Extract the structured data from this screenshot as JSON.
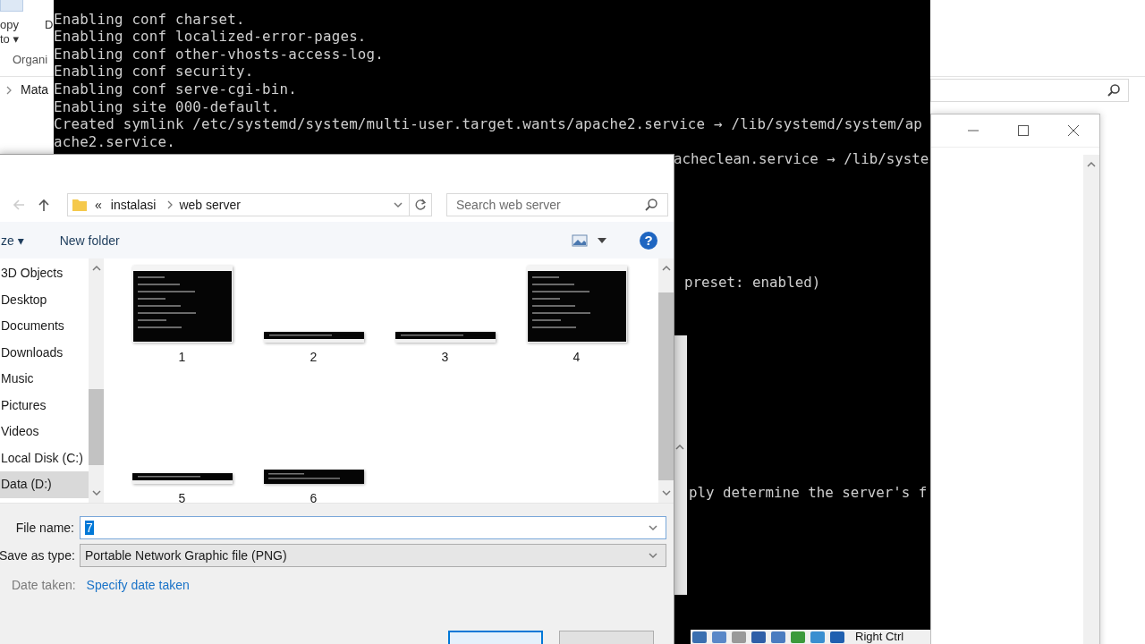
{
  "background_window": {
    "ribbon_labels": [
      "opy",
      "to ▾",
      "D"
    ],
    "group_label": "Organi",
    "nav_item": "Mata"
  },
  "terminal": {
    "lines": [
      "Enabling conf charset.",
      "Enabling conf localized-error-pages.",
      "Enabling conf other-vhosts-access-log.",
      "Enabling conf security.",
      "Enabling conf serve-cgi-bin.",
      "Enabling site 000-default.",
      "Created symlink /etc/systemd/system/multi-user.target.wants/apache2.service → /lib/systemd/system/ap",
      "ache2.service."
    ],
    "peek_lines": [
      "acheclean.service → /lib/syste",
      "preset: enabled)",
      "ply determine the server's f"
    ],
    "host_key": "Right Ctrl"
  },
  "save_dialog": {
    "address": {
      "overflow": "«",
      "crumbs": [
        "instalasi",
        "web server"
      ]
    },
    "search": {
      "placeholder": "Search web server"
    },
    "toolbar": {
      "organize": "ze ▾",
      "new_folder": "New folder",
      "help": "?"
    },
    "nav_items": [
      {
        "label": "3D Objects",
        "selected": false
      },
      {
        "label": "Desktop",
        "selected": false
      },
      {
        "label": "Documents",
        "selected": false
      },
      {
        "label": "Downloads",
        "selected": false
      },
      {
        "label": "Music",
        "selected": false
      },
      {
        "label": "Pictures",
        "selected": false
      },
      {
        "label": "Videos",
        "selected": false
      },
      {
        "label": "Local Disk (C:)",
        "selected": false
      },
      {
        "label": "Data  (D:)",
        "selected": true
      }
    ],
    "files": [
      {
        "label": "1",
        "kind": "screen"
      },
      {
        "label": "2",
        "kind": "strip"
      },
      {
        "label": "3",
        "kind": "strip"
      },
      {
        "label": "4",
        "kind": "screen"
      },
      {
        "label": "5",
        "kind": "strip"
      },
      {
        "label": "6",
        "kind": "band"
      }
    ],
    "file_name": {
      "label": "File name:",
      "value": "7",
      "selected": true
    },
    "save_as_type": {
      "label": "Save as type:",
      "value": "Portable Network Graphic file (PNG)"
    },
    "date_taken": {
      "label": "Date taken:",
      "link": "Specify date taken"
    },
    "buttons": [
      {
        "default": true
      },
      {
        "default": false
      }
    ]
  }
}
